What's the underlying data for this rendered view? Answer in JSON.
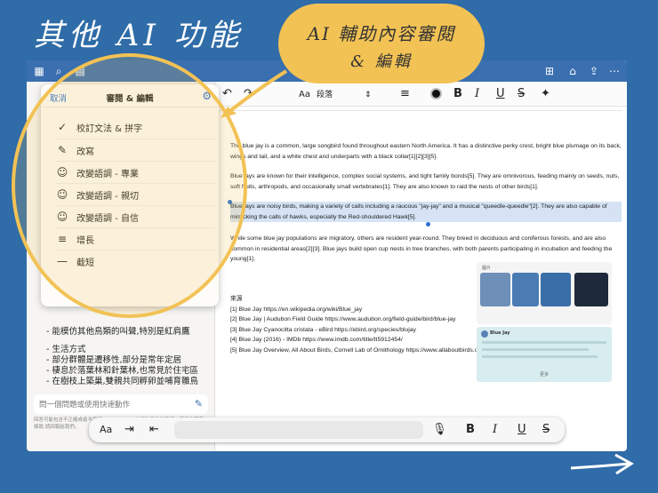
{
  "page_title": "其他 AI 功能",
  "callout": {
    "line1": "AI 輔助內容審閱",
    "line2": "& 編輯"
  },
  "top_icons": [
    "grid-icon",
    "search-icon",
    "notebook-icon",
    "new-page-icon",
    "bookmark-icon",
    "share-icon",
    "more-icon"
  ],
  "toolbar": {
    "undo": "↶",
    "redo": "↷",
    "style_short": "Aa",
    "style_value": "段落",
    "bold": "B",
    "italic": "I",
    "underline": "U",
    "strike": "S"
  },
  "panel": {
    "cancel": "取消",
    "title": "審閱 & 編輯",
    "items": [
      {
        "icon": "check-circle-icon",
        "glyph": "✓",
        "label": "校訂文法 & 拼字"
      },
      {
        "icon": "feather-icon",
        "glyph": "✎",
        "label": "改寫"
      },
      {
        "icon": "smiley-icon",
        "glyph": "☺",
        "label": "改變語調 - 專業"
      },
      {
        "icon": "smiley-icon",
        "glyph": "☺",
        "label": "改變語調 - 親切"
      },
      {
        "icon": "smiley-icon",
        "glyph": "☺",
        "label": "改變語調 - 自信"
      },
      {
        "icon": "lines-icon",
        "glyph": "≡",
        "label": "增長"
      },
      {
        "icon": "line-icon",
        "glyph": "—",
        "label": "截短"
      }
    ]
  },
  "sidebar": {
    "notes": [
      "- 能模仿其他鳥類的叫聲,特別是紅肩鷹",
      "",
      "- 生活方式",
      "  - 部分群體是遷移性,部分是常年定居",
      "  - 棲息於落葉林和針葉林,也常見於住宅區",
      "  - 在樹枝上築巢,雙親共同孵卵並哺育雛鳥"
    ],
    "input_placeholder": "問一個問題或使用快速動作",
    "disclaimer": "回答可能包含不正確或者不完整。Goodnotes 立場的不恰當資訊。適用此服務條款,請回報給我們。"
  },
  "document": {
    "paragraphs": [
      "The blue jay is a common, large songbird found throughout eastern North America. It has a distinctive perky crest, bright blue plumage on its back, wings and tail, and a white chest and underparts with a black collar[1][2][3][5].",
      "Blue jays are known for their intelligence, complex social systems, and tight family bonds[5]. They are omnivorous, feeding mainly on seeds, nuts, soft fruits, arthropods, and occasionally small vertebrates[1]. They are also known to raid the nests of other birds[1].",
      "Blue jays are noisy birds, making a variety of calls including a raucous \"jay-jay\" and a musical \"queedle-queedle\"[2]. They are also capable of mimicking the calls of hawks, especially the Red-shouldered Hawk[5].",
      "While some blue jay populations are migratory, others are resident year-round. They breed in deciduous and coniferous forests, and are also common in residential areas[2][3]. Blue jays build open cup nests in tree branches, with both parents participating in incubation and feeding the young[1]."
    ],
    "sources_heading": "來源",
    "sources": [
      "[1] Blue Jay https://en.wikipedia.org/wiki/Blue_jay",
      "[2] Blue Jay | Audubon Field Guide https://www.audubon.org/field-guide/bird/blue-jay",
      "[3] Blue Jay Cyanocitta cristata - eBird https://ebird.org/species/blujay",
      "[4] Blue Jay (2016) - IMDb https://www.imdb.com/title/tt5912454/",
      "[5] Blue Jay Overview, All About Birds, Cornell Lab of Ornithology https://www.allaboutbirds.org/guide/Blue_Jay/overview"
    ],
    "image_card_label": "圖片",
    "info_card_title": "Blue Jay",
    "info_card_more": "更多"
  },
  "bottombar": {
    "format": "Aa",
    "indent": "⇥",
    "outdent": "⇤",
    "bold": "B",
    "italic": "I",
    "underline": "U",
    "strike": "S"
  }
}
